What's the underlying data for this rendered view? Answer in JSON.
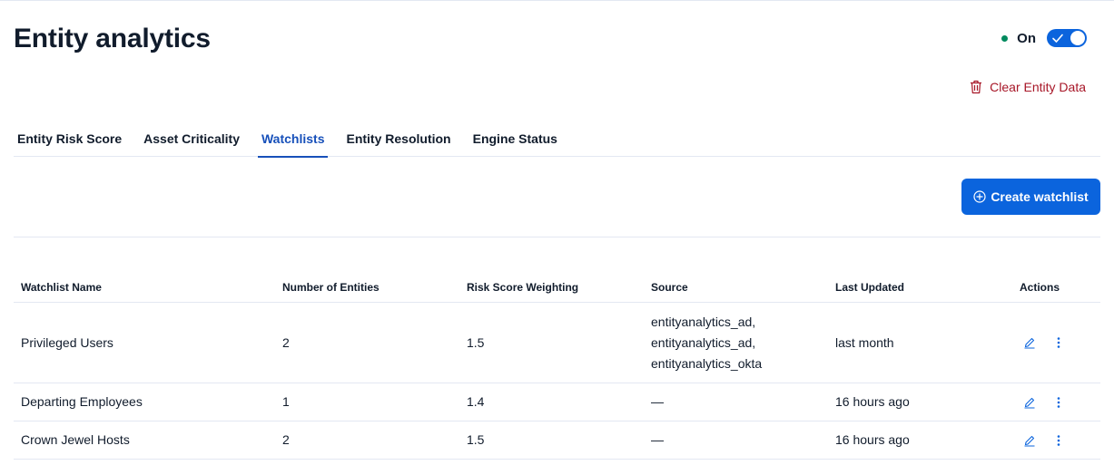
{
  "header": {
    "title": "Entity analytics",
    "status_label": "On",
    "clear_label": "Clear Entity Data"
  },
  "tabs": [
    {
      "label": "Entity Risk Score",
      "active": false
    },
    {
      "label": "Asset Criticality",
      "active": false
    },
    {
      "label": "Watchlists",
      "active": true
    },
    {
      "label": "Entity Resolution",
      "active": false
    },
    {
      "label": "Engine Status",
      "active": false
    }
  ],
  "toolbar": {
    "create_label": "Create watchlist"
  },
  "table": {
    "columns": [
      "Watchlist Name",
      "Number of Entities",
      "Risk Score Weighting",
      "Source",
      "Last Updated",
      "Actions"
    ],
    "rows": [
      {
        "name": "Privileged Users",
        "entities": "2",
        "weighting": "1.5",
        "source": [
          "entityanalytics_ad,",
          "entityanalytics_ad,",
          "entityanalytics_okta"
        ],
        "updated": "last month"
      },
      {
        "name": "Departing Employees",
        "entities": "1",
        "weighting": "1.4",
        "source": [
          "—"
        ],
        "updated": "16 hours ago"
      },
      {
        "name": "Crown Jewel Hosts",
        "entities": "2",
        "weighting": "1.5",
        "source": [
          "—"
        ],
        "updated": "16 hours ago"
      }
    ]
  },
  "colors": {
    "primary": "#0b64dd",
    "danger": "#a71627",
    "active_tab": "#1750ba",
    "status_dot": "#008a5e"
  },
  "icons": {
    "toggle": "check-icon",
    "clear": "trash-icon",
    "create": "plus-circle-icon",
    "edit": "pencil-icon",
    "more": "more-vertical-icon"
  }
}
